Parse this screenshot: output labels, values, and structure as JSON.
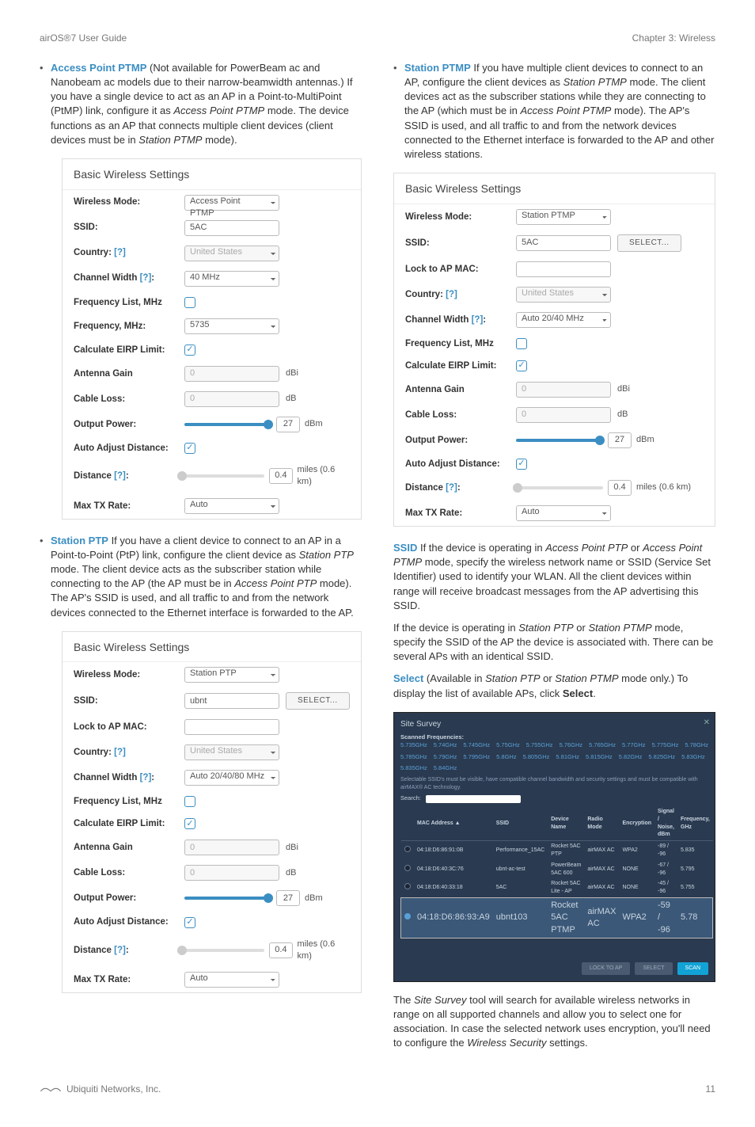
{
  "header": {
    "left": "airOS®7 User Guide",
    "right": "Chapter 3: Wireless"
  },
  "footer": {
    "company": "Ubiquiti Networks, Inc.",
    "page": "11"
  },
  "left_col": {
    "ap_ptmp_term": "Access Point PTMP",
    "ap_ptmp_text1": "  (Not available for PowerBeam ac and Nanobeam ac models due to their narrow-beamwidth antennas.) If you have a single device to act as an AP in a Point-to-MultiPoint (PtMP) link, configure it as ",
    "ap_ptmp_ital1": "Access Point PTMP",
    "ap_ptmp_text2": " mode. The device functions as an AP that connects multiple client devices (client devices must be in ",
    "ap_ptmp_ital2": "Station PTMP",
    "ap_ptmp_text3": " mode).",
    "station_ptp_term": "Station PTP",
    "station_ptp_text1": "  If you have a client device to connect to an AP in a Point-to-Point (PtP) link, configure the client device as ",
    "station_ptp_ital1": "Station PTP",
    "station_ptp_text2": " mode. The client device acts as the subscriber station while connecting to the AP (the AP must be in ",
    "station_ptp_ital2": "Access Point PTP",
    "station_ptp_text3": " mode). The AP's SSID is used, and all traffic to and from the network devices connected to the Ethernet interface is forwarded to the AP."
  },
  "right_col": {
    "station_ptmp_term": "Station PTMP",
    "station_ptmp_text1": "  If you have multiple client devices to connect to an AP, configure the client devices as ",
    "station_ptmp_ital1": "Station PTMP",
    "station_ptmp_text2": " mode. The client devices act as the subscriber stations while they are connecting to the AP (which must be in ",
    "station_ptmp_ital2": "Access Point PTMP",
    "station_ptmp_text3": " mode). The AP's SSID is used, and all traffic to and from the network devices connected to the Ethernet interface is forwarded to the AP and other wireless stations.",
    "ssid_term": "SSID",
    "ssid_text1": "  If the device is operating in ",
    "ssid_ital1": "Access Point PTP",
    "ssid_text2": " or ",
    "ssid_ital2": "Access Point PTMP",
    "ssid_text3": " mode, specify the wireless network name or SSID (Service Set Identifier) used to identify your WLAN. All the client devices within range will receive broadcast messages from the AP advertising this SSID.",
    "ssid_p2_text1": "If the device is operating in ",
    "ssid_p2_ital1": "Station PTP",
    "ssid_p2_text2": " or ",
    "ssid_p2_ital2": "Station PTMP",
    "ssid_p2_text3": " mode, specify the SSID of the AP the device is associated with. There can be several APs with an identical SSID.",
    "select_term": "Select",
    "select_text1": "  (Available in ",
    "select_ital1": "Station PTP",
    "select_text2": " or ",
    "select_ital2": "Station PTMP",
    "select_text3": " mode only.) To display the list of available APs, click ",
    "select_bold": "Select",
    "select_text4": ".",
    "survey_p_text1": "The ",
    "survey_p_ital1": "Site Survey",
    "survey_p_text2": " tool will search for available wireless networks in range on all supported channels and allow you to select one for association. In case the selected network uses encryption, you'll need to configure the ",
    "survey_p_ital2": "Wireless Security",
    "survey_p_text3": " settings."
  },
  "panels": {
    "common_title": "Basic Wireless Settings",
    "labels": {
      "mode": "Wireless Mode:",
      "ssid": "SSID:",
      "lock": "Lock to AP MAC:",
      "country": "Country: [?]",
      "width": "Channel Width [?]:",
      "freqlist": "Frequency List, MHz",
      "freq": "Frequency, MHz:",
      "eirp": "Calculate EIRP Limit:",
      "gain": "Antenna Gain",
      "loss": "Cable Loss:",
      "power": "Output Power:",
      "autoadj": "Auto Adjust Distance:",
      "distance": "Distance [?]:",
      "maxtx": "Max TX Rate:"
    },
    "units": {
      "dbi": "dBi",
      "db": "dB",
      "dbm": "dBm",
      "miles": "miles (0.6 km)"
    },
    "select_btn": "SELECT...",
    "values": {
      "country": "United States",
      "gain": "0",
      "loss": "0",
      "power_val": "27",
      "distance_val": "0.4",
      "maxtx": "Auto"
    },
    "p1": {
      "mode": "Access Point PTMP",
      "ssid": "5AC",
      "width": "40 MHz",
      "freq": "5735"
    },
    "p2": {
      "mode": "Station PTP",
      "ssid": "ubnt",
      "width": "Auto 20/40/80 MHz"
    },
    "p3": {
      "mode": "Station PTMP",
      "ssid": "5AC",
      "width": "Auto 20/40 MHz"
    }
  },
  "survey": {
    "title": "Site Survey",
    "scanned_label": "Scanned Frequencies:",
    "freqs": [
      "5.735GHz",
      "5.74GHz",
      "5.745GHz",
      "5.75GHz",
      "5.755GHz",
      "5.76GHz",
      "5.765GHz",
      "5.77GHz",
      "5.775GHz",
      "5.78GHz",
      "5.785GHz",
      "5.79GHz",
      "5.795GHz",
      "5.8GHz",
      "5.805GHz",
      "5.81GHz",
      "5.815GHz",
      "5.82GHz",
      "5.825GHz",
      "5.83GHz",
      "5.835GHz",
      "5.84GHz"
    ],
    "note": "Selectable SSID's must be visible, have compatible channel bandwidth and security settings and must be compatible with airMAX® AC technology.",
    "search_label": "Search:",
    "headers": [
      "",
      "MAC Address ▲",
      "SSID",
      "Device Name",
      "Radio Mode",
      "Encryption",
      "Signal / Noise, dBm",
      "Frequency, GHz"
    ],
    "rows": [
      [
        "",
        "04:18:D6:86:91:0B",
        "Performance_15AC",
        "Rocket 5AC PTP",
        "airMAX AC",
        "WPA2",
        "-89 / -96",
        "5.835"
      ],
      [
        "",
        "04:18:D6:40:3C:76",
        "ubnt-ac-test",
        "PowerBeam 5AC 600",
        "airMAX AC",
        "NONE",
        "-67 / -96",
        "5.795"
      ],
      [
        "",
        "04:18:D6:40:33:18",
        "5AC",
        "Rocket 5AC Lite - AP",
        "airMAX AC",
        "NONE",
        "-45 / -96",
        "5.755"
      ],
      [
        "sel",
        "04:18:D6:86:93:A9",
        "ubnt103",
        "Rocket 5AC PTMP",
        "airMAX AC",
        "WPA2",
        "-59 / -96",
        "5.78"
      ]
    ],
    "btns": {
      "lock": "LOCK TO AP",
      "select": "SELECT",
      "scan": "SCAN"
    }
  }
}
